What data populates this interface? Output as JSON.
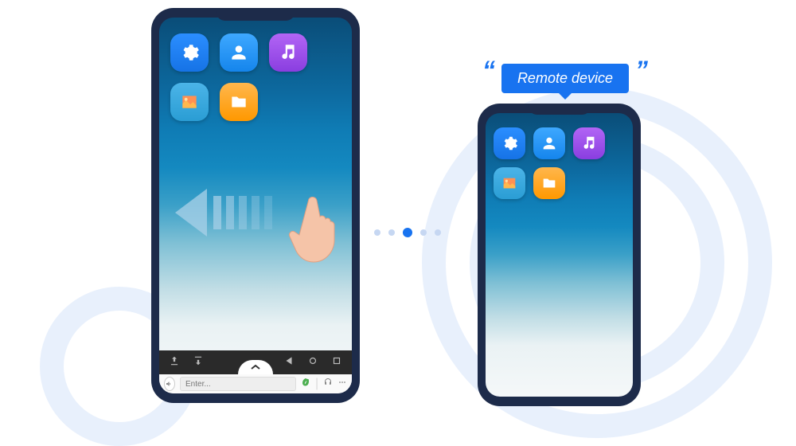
{
  "callout": {
    "label": "Remote device",
    "quote_open": "“",
    "quote_close": "”"
  },
  "local_device": {
    "apps": [
      {
        "name": "settings",
        "type": "gear"
      },
      {
        "name": "contacts",
        "type": "person"
      },
      {
        "name": "music",
        "type": "note"
      },
      {
        "name": "gallery",
        "type": "image"
      },
      {
        "name": "files",
        "type": "folder"
      }
    ],
    "control_bar": {
      "upload_icon": "upload",
      "download_icon": "download",
      "back_icon": "back",
      "home_icon": "home",
      "recent_icon": "recent"
    },
    "input_bar": {
      "sound_icon": "volume",
      "placeholder": "Enter...",
      "eco_icon": "leaf",
      "headset_icon": "headset",
      "more_icon": "more"
    }
  },
  "remote_device": {
    "apps": [
      {
        "name": "settings",
        "type": "gear"
      },
      {
        "name": "contacts",
        "type": "person"
      },
      {
        "name": "music",
        "type": "note"
      },
      {
        "name": "gallery",
        "type": "image"
      },
      {
        "name": "files",
        "type": "folder"
      }
    ]
  },
  "gesture": {
    "direction": "left",
    "hint": "swipe-left"
  }
}
